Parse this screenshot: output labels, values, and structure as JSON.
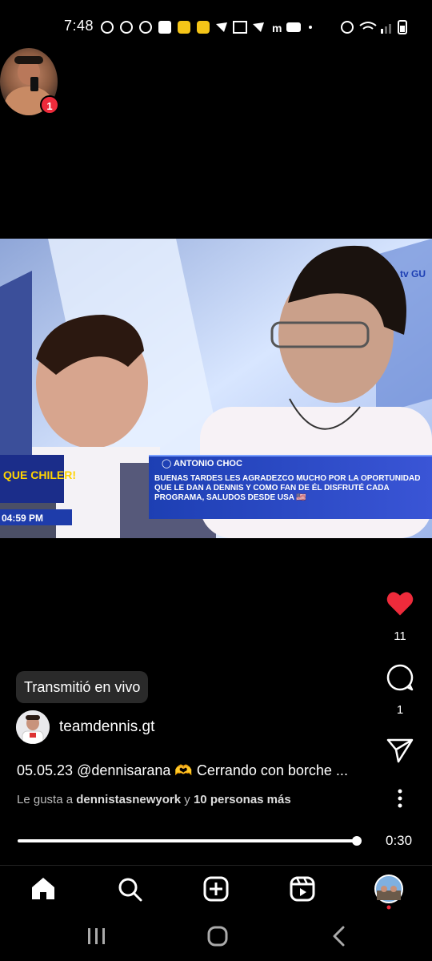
{
  "status_bar": {
    "time": "7:48"
  },
  "top_avatar": {
    "badge_count": "1"
  },
  "video": {
    "overlay_name": "ANTONIO CHOC",
    "overlay_message": "BUENAS TARDES LES AGRADEZCO MUCHO POR LA OPORTUNIDAD QUE LE DAN A DENNIS Y COMO FAN DE ÉL DISFRUTÉ CADA PROGRAMA, SALUDOS DESDE USA 🇺🇸",
    "show_logo_text": "QUE CHILER!",
    "show_time": "04:59 PM",
    "channel_text": "tv GU"
  },
  "actions": {
    "likes_count": "11",
    "comments_count": "1"
  },
  "post": {
    "live_label": "Transmitió en vivo",
    "username": "teamdennis.gt",
    "caption": "05.05.23  @dennisarana 🫶 Cerrando con borche ...",
    "liked_prefix": "Le gusta a ",
    "liked_user": "dennistasnewyork",
    "liked_mid": " y ",
    "liked_others": "10 personas más"
  },
  "player": {
    "time_remaining": "0:30",
    "progress": 0.98
  },
  "bottom_nav": {
    "items": [
      "home-icon",
      "search-icon",
      "create-icon",
      "reels-icon",
      "profile-avatar"
    ]
  },
  "colors": {
    "heart": "#ee2b3b",
    "overlay_blue": "#2446c4",
    "badge": "#ee2b3b"
  }
}
